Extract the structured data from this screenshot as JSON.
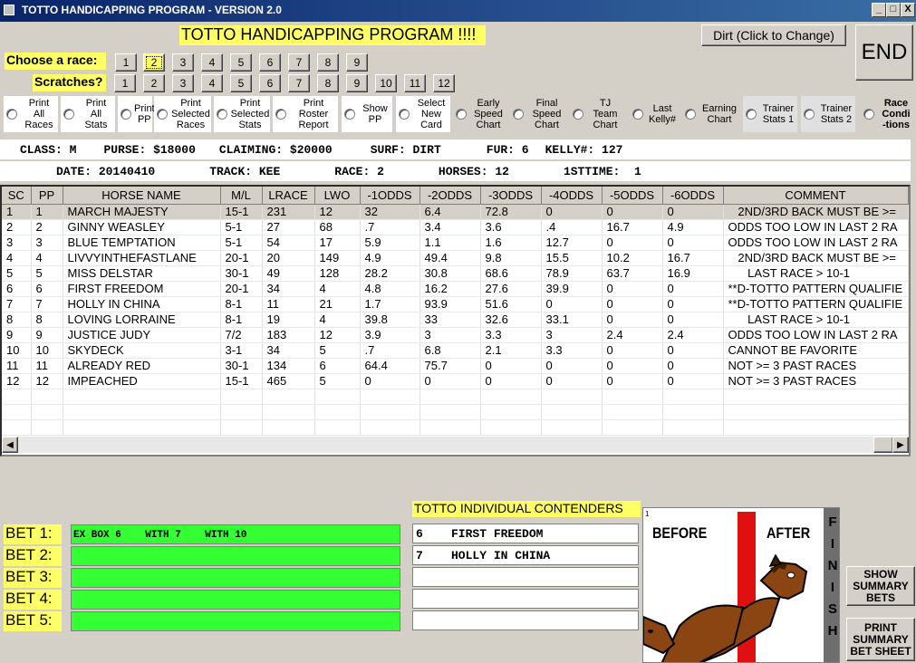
{
  "window": {
    "title": "TOTTO HANDICAPPING PROGRAM - VERSION 2.0",
    "min": "_",
    "max": "□",
    "close": "X"
  },
  "banner": "TOTTO HANDICAPPING PROGRAM !!!!",
  "surface_button": "Dirt (Click to Change)",
  "end_button": "END",
  "choose_race_label": "Choose  a race:",
  "race_buttons": [
    "1",
    "2",
    "3",
    "4",
    "5",
    "6",
    "7",
    "8",
    "9"
  ],
  "selected_race": "2",
  "scratches_label": "Scratches?",
  "scratch_buttons": [
    "1",
    "2",
    "3",
    "4",
    "5",
    "6",
    "7",
    "8",
    "9",
    "10",
    "11",
    "12"
  ],
  "options": [
    {
      "label": "Print\nAll\nRaces"
    },
    {
      "label": "Print\nAll\nStats"
    },
    {
      "label": "Print\nPP"
    },
    {
      "label": "Print\nSelected\nRaces"
    },
    {
      "label": "Print\nSelected\nStats"
    },
    {
      "label": "Print\nRoster\nReport"
    },
    {
      "label": "Show\nPP"
    },
    {
      "label": "Select\nNew\nCard"
    },
    {
      "label": "Early\nSpeed\nChart"
    },
    {
      "label": "Final\nSpeed\nChart"
    },
    {
      "label": "TJ\nTeam\nChart"
    },
    {
      "label": "Last\nKelly#"
    },
    {
      "label": "Earning\nChart"
    },
    {
      "label": "Trainer\nStats 1"
    },
    {
      "label": "Trainer\nStats 2"
    },
    {
      "label": "Race\nCondi\n-tions"
    }
  ],
  "info1": {
    "class_label": "CLASS:",
    "class_value": "M",
    "purse_label": "PURSE:",
    "purse_value": "$18000",
    "claiming_label": "CLAIMING:",
    "claiming_value": "$20000",
    "surf_label": "SURF:",
    "surf_value": "DIRT",
    "fur_label": "FUR:",
    "fur_value": "6",
    "kelly_label": "KELLY#:",
    "kelly_value": "127"
  },
  "info2": {
    "date_label": "DATE:",
    "date_value": "20140410",
    "track_label": "TRACK:",
    "track_value": "KEE",
    "race_label": "RACE:",
    "race_value": "2",
    "horses_label": "HORSES:",
    "horses_value": "12",
    "firsttime_label": "1STTIME:",
    "firsttime_value": "1"
  },
  "grid": {
    "columns": [
      "SC",
      "PP",
      "HORSE NAME",
      "M/L",
      "LRACE",
      "LWO",
      "-1ODDS",
      "-2ODDS",
      "-3ODDS",
      "-4ODDS",
      "-5ODDS",
      "-6ODDS",
      "COMMENT"
    ],
    "rows": [
      [
        "1",
        "1",
        "MARCH MAJESTY",
        "15-1",
        "231",
        "12",
        "32",
        "6.4",
        "72.8",
        "0",
        "0",
        "0",
        "   2ND/3RD BACK MUST BE >="
      ],
      [
        "2",
        "2",
        "GINNY WEASLEY",
        "5-1",
        "27",
        "68",
        ".7",
        "3.4",
        "3.6",
        ".4",
        "16.7",
        "4.9",
        "ODDS TOO LOW IN LAST 2 RA"
      ],
      [
        "3",
        "3",
        "BLUE TEMPTATION",
        "5-1",
        "54",
        "17",
        "5.9",
        "1.1",
        "1.6",
        "12.7",
        "0",
        "0",
        "ODDS TOO LOW IN LAST 2 RA"
      ],
      [
        "4",
        "4",
        "LIVVYINTHEFASTLANE",
        "20-1",
        "20",
        "149",
        "4.9",
        "49.4",
        "9.8",
        "15.5",
        "10.2",
        "16.7",
        "   2ND/3RD BACK MUST BE >="
      ],
      [
        "5",
        "5",
        "MISS DELSTAR",
        "30-1",
        "49",
        "128",
        "28.2",
        "30.8",
        "68.6",
        "78.9",
        "63.7",
        "16.9",
        "      LAST RACE > 10-1"
      ],
      [
        "6",
        "6",
        "FIRST FREEDOM",
        "20-1",
        "34",
        "4",
        "4.8",
        "16.2",
        "27.6",
        "39.9",
        "0",
        "0",
        "**D-TOTTO PATTERN QUALIFIE"
      ],
      [
        "7",
        "7",
        "HOLLY IN CHINA",
        "8-1",
        "11",
        "21",
        "1.7",
        "93.9",
        "51.6",
        "0",
        "0",
        "0",
        "**D-TOTTO PATTERN QUALIFIE"
      ],
      [
        "8",
        "8",
        "LOVING LORRAINE",
        "8-1",
        "19",
        "4",
        "39.8",
        "33",
        "32.6",
        "33.1",
        "0",
        "0",
        "      LAST RACE > 10-1"
      ],
      [
        "9",
        "9",
        "JUSTICE JUDY",
        "7/2",
        "183",
        "12",
        "3.9",
        "3",
        "3.3",
        "3",
        "2.4",
        "2.4",
        "ODDS TOO LOW IN LAST 2 RA"
      ],
      [
        "10",
        "10",
        "SKYDECK",
        "3-1",
        "34",
        "5",
        ".7",
        "6.8",
        "2.1",
        "3.3",
        "0",
        "0",
        "CANNOT BE FAVORITE"
      ],
      [
        "11",
        "11",
        "ALREADY RED",
        "30-1",
        "134",
        "6",
        "64.4",
        "75.7",
        "0",
        "0",
        "0",
        "0",
        "NOT >= 3 PAST RACES"
      ],
      [
        "12",
        "12",
        "IMPEACHED",
        "15-1",
        "465",
        "5",
        "0",
        "0",
        "0",
        "0",
        "0",
        "0",
        "NOT >= 3 PAST RACES"
      ]
    ]
  },
  "bets": [
    {
      "label": "BET 1:",
      "value": "EX BOX 6    WITH 7    WITH 10"
    },
    {
      "label": "BET 2:",
      "value": ""
    },
    {
      "label": "BET 3:",
      "value": ""
    },
    {
      "label": "BET 4:",
      "value": ""
    },
    {
      "label": "BET 5:",
      "value": ""
    }
  ],
  "contenders_title": "TOTTO INDIVIDUAL CONTENDERS",
  "contenders": [
    "6    FIRST FREEDOM",
    "7    HOLLY IN CHINA",
    "",
    "",
    ""
  ],
  "finish_image": {
    "before": "BEFORE",
    "after": "AFTER",
    "finish": "FINISH",
    "corner": "1"
  },
  "show_summary_button": "SHOW\nSUMMARY\nBETS",
  "print_summary_button": "PRINT\nSUMMARY\nBET SHEET",
  "colors": {
    "accent_yellow": "#ffff66",
    "bet_green": "#33ff33",
    "title_blue": "#0a246a"
  }
}
